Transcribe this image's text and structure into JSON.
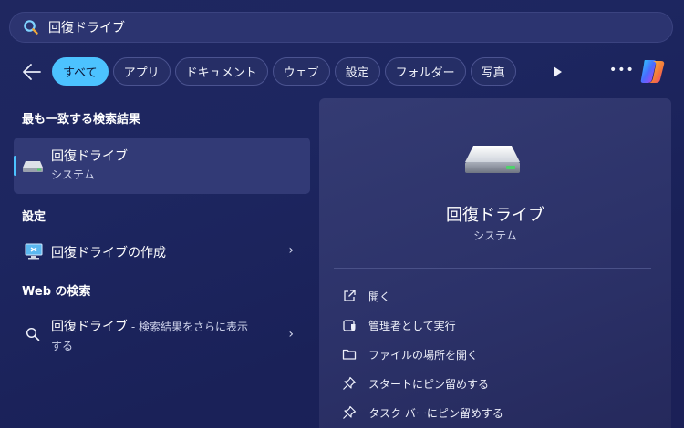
{
  "search": {
    "query": "回復ドライブ"
  },
  "filters": [
    "すべて",
    "アプリ",
    "ドキュメント",
    "ウェブ",
    "設定",
    "フォルダー",
    "写真"
  ],
  "more_dots": "•••",
  "left": {
    "best_match_heading": "最も一致する検索結果",
    "best_match": {
      "title": "回復ドライブ",
      "subtitle": "システム"
    },
    "settings_heading": "設定",
    "settings_item": {
      "label": "回復ドライブの作成"
    },
    "web_heading": "Web の検索",
    "web_item": {
      "query": "回復ドライブ",
      "suffix": " - 検索結果をさらに表示",
      "line2": "する"
    }
  },
  "detail": {
    "title": "回復ドライブ",
    "subtitle": "システム",
    "actions": [
      "開く",
      "管理者として実行",
      "ファイルの場所を開く",
      "スタートにピン留めする",
      "タスク バーにピン留めする"
    ]
  },
  "colors": {
    "accent": "#4cc2ff",
    "background": "#1d2660",
    "panel": "#2c3269"
  }
}
